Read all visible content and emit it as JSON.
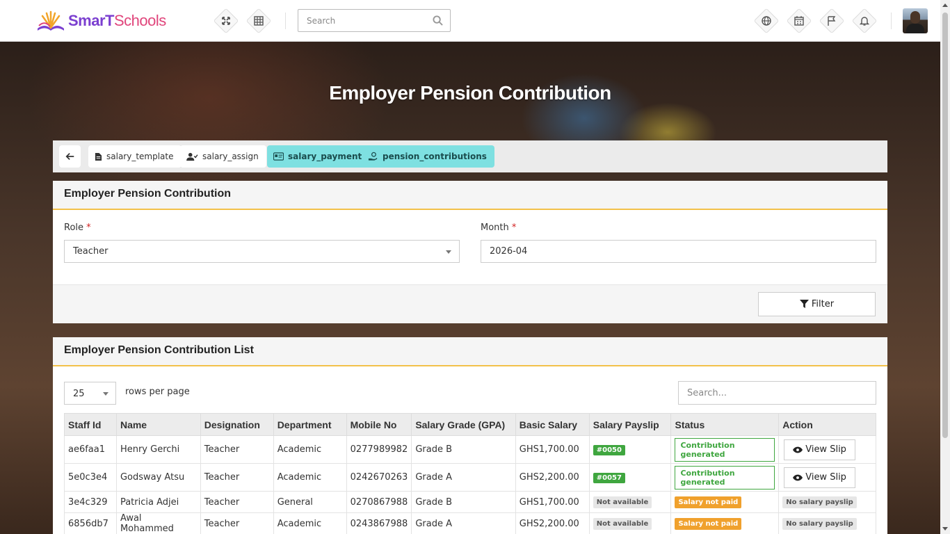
{
  "brand": {
    "part1": "SmarT",
    "part2": "Schools"
  },
  "search": {
    "placeholder": "Search"
  },
  "page_title": "Employer Pension Contribution",
  "tabs": [
    {
      "label": "salary_template",
      "icon": "file-icon",
      "active": false
    },
    {
      "label": "salary_assign",
      "icon": "user-check-icon",
      "active": false
    },
    {
      "label": "salary_payment",
      "icon": "id-card-icon",
      "active": true
    },
    {
      "label": "pension_contributions",
      "icon": "hand-coin-icon",
      "active": true
    }
  ],
  "filter_panel": {
    "title": "Employer Pension Contribution",
    "role_label": "Role",
    "role_value": "Teacher",
    "month_label": "Month",
    "month_value": "2026-04",
    "required_mark": "*",
    "filter_button": "Filter"
  },
  "list_panel": {
    "title": "Employer Pension Contribution List",
    "rows_per_page_value": "25",
    "rows_per_page_label": "rows per page",
    "search_placeholder": "Search...",
    "columns": [
      "Staff Id",
      "Name",
      "Designation",
      "Department",
      "Mobile No",
      "Salary Grade (GPA)",
      "Basic Salary",
      "Salary Payslip",
      "Status",
      "Action"
    ],
    "rows": [
      {
        "staff_id": "ae6faa1",
        "name": "Henry Gerchi",
        "designation": "Teacher",
        "department": "Academic",
        "mobile": "0277989982",
        "grade": "Grade B",
        "basic_salary": "GHS1,700.00",
        "payslip": "#0050",
        "status": "Contribution generated",
        "action": "View Slip"
      },
      {
        "staff_id": "5e0c3e4",
        "name": "Godsway Atsu",
        "designation": "Teacher",
        "department": "Academic",
        "mobile": "0242670263",
        "grade": "Grade A",
        "basic_salary": "GHS2,200.00",
        "payslip": "#0057",
        "status": "Contribution generated",
        "action": "View Slip"
      },
      {
        "staff_id": "3e4c329",
        "name": "Patricia Adjei",
        "designation": "Teacher",
        "department": "General",
        "mobile": "0270867988",
        "grade": "Grade B",
        "basic_salary": "GHS1,700.00",
        "payslip": "Not available",
        "status": "Salary not paid",
        "action": "No salary payslip"
      },
      {
        "staff_id": "6856db7",
        "name": "Awal Mohammed",
        "designation": "Teacher",
        "department": "Academic",
        "mobile": "0243867988",
        "grade": "Grade A",
        "basic_salary": "GHS2,200.00",
        "payslip": "Not available",
        "status": "Salary not paid",
        "action": "No salary payslip"
      }
    ]
  },
  "colors": {
    "accent_tab": "#7ee0e1",
    "panel_underline": "#f2c14a",
    "success": "#3fa63f",
    "warning": "#f0a12d"
  }
}
